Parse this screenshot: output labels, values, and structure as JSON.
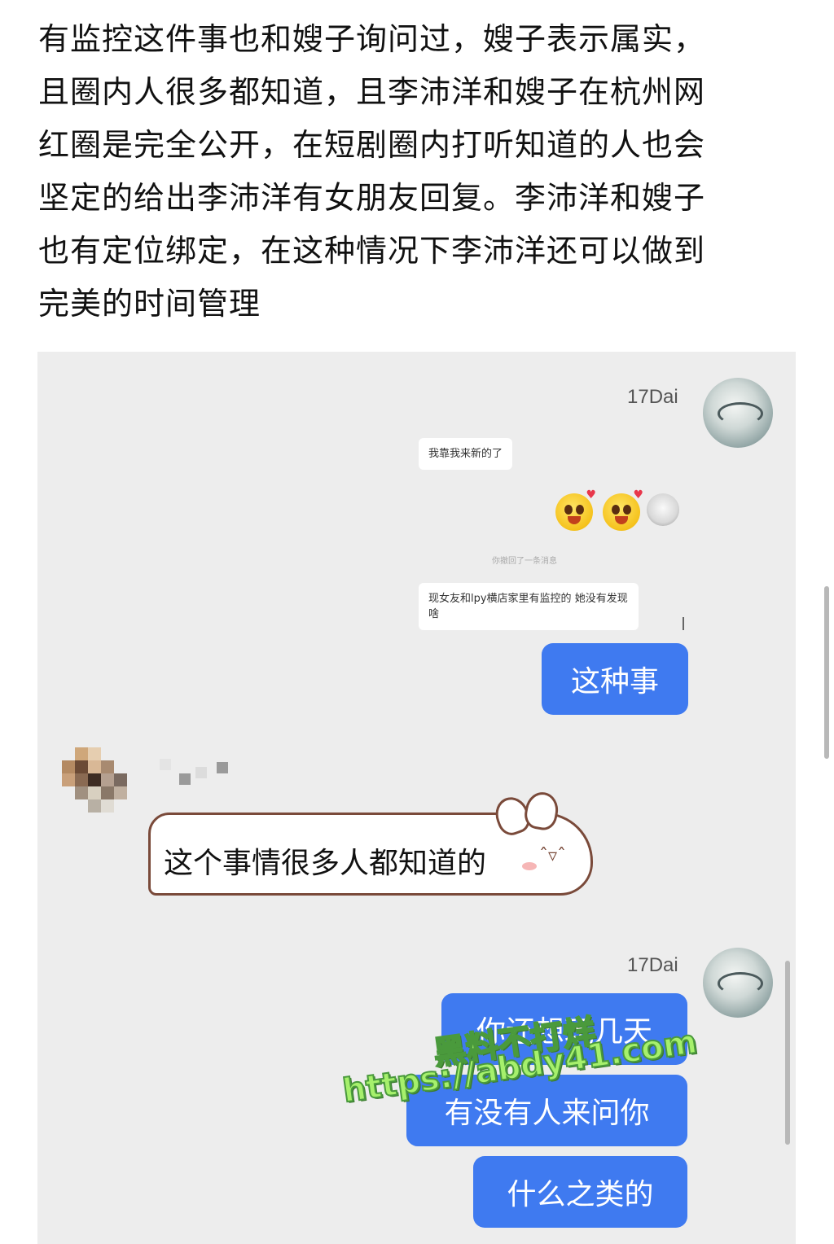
{
  "post": {
    "lines": [
      "有监控这件事也和嫂子询问过，嫂子表示属实，",
      "且圈内人很多都知道，且李沛洋和嫂子在杭州网",
      "红圈是完全公开，在短剧圈内打听知道的人也会",
      "坚定的给出李沛洋有女朋友回复。李沛洋和嫂子",
      "也有定位绑定，在这种情况下李沛洋还可以做到",
      "完美的时间管理"
    ]
  },
  "chat": {
    "me_name": "17Dai",
    "quoted_1": "我靠我来新的了",
    "recall_notice": "你撤回了一条消息",
    "quoted_2": "现女友和lpy横店家里有监控的 她没有发现啥",
    "msg_1": "这种事",
    "other_reply": "这个事情很多人都知道的",
    "me_name_2": "17Dai",
    "msg_2": "你还想玩几天",
    "msg_3": "有没有人来问你",
    "msg_4": "什么之类的",
    "colors": {
      "bubble_blue": "#3f7af0",
      "chat_bg": "#ededed"
    }
  },
  "watermark": {
    "line1": "黑料不打烊",
    "line2": "https://abdy41.com"
  }
}
